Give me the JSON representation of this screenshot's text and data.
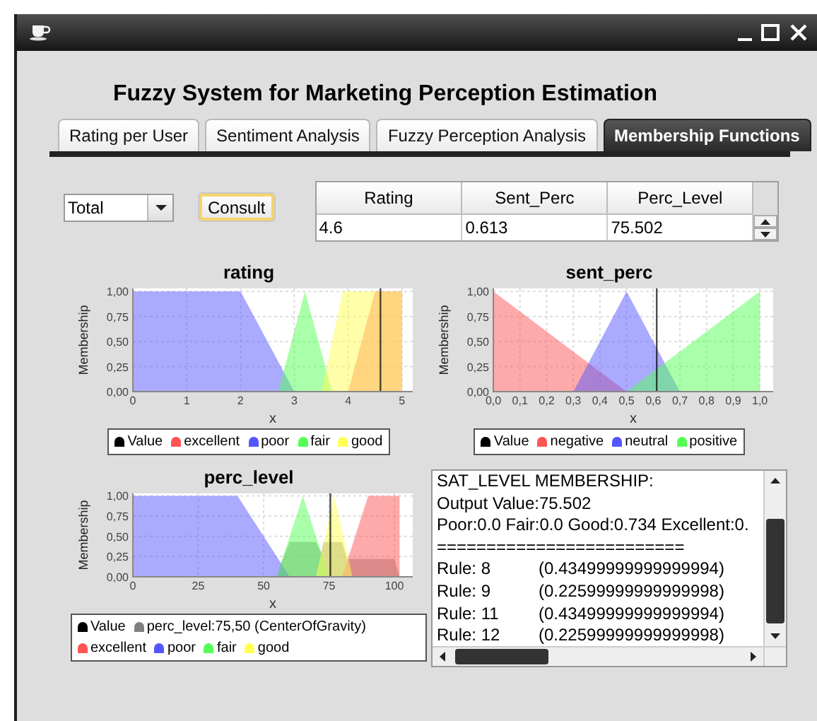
{
  "heading": "Fuzzy System for Marketing Perception Estimation",
  "tabs": [
    {
      "label": "Rating per User",
      "selected": false
    },
    {
      "label": "Sentiment Analysis",
      "selected": false
    },
    {
      "label": "Fuzzy Perception Analysis",
      "selected": false
    },
    {
      "label": "Membership Functions",
      "selected": true
    }
  ],
  "scope_select": {
    "value": "Total"
  },
  "consult_button": {
    "label": "Consult",
    "focused": true
  },
  "results_table": {
    "columns": [
      "Rating",
      "Sent_Perc",
      "Perc_Level"
    ],
    "rows": [
      [
        "4.6",
        "0.613",
        "75.502"
      ]
    ]
  },
  "charts": [
    {
      "chart_data": {
        "type": "area",
        "title": "rating",
        "xlabel": "x",
        "ylabel": "Membership",
        "x": [
          0,
          2,
          2.7,
          3,
          3.2,
          3.5,
          3.7,
          3.9,
          4,
          4.5,
          5,
          5
        ],
        "series": [
          {
            "name": "excellent",
            "color": "#ff5555",
            "values": [
              null,
              null,
              null,
              null,
              null,
              null,
              null,
              null,
              0,
              1,
              1,
              0
            ]
          },
          {
            "name": "poor",
            "color": "#5555ff",
            "values": [
              1,
              1,
              0.3,
              0,
              null,
              null,
              null,
              null,
              null,
              null,
              null,
              null
            ]
          },
          {
            "name": "fair",
            "color": "#55ff55",
            "values": [
              null,
              null,
              0,
              0.6,
              1,
              0.4,
              0,
              null,
              null,
              null,
              null,
              null
            ]
          },
          {
            "name": "good",
            "color": "#ffff55",
            "values": [
              null,
              null,
              null,
              null,
              null,
              0,
              0.5,
              1,
              1,
              1,
              1,
              0
            ]
          }
        ],
        "xlim": [
          0,
          5.2
        ],
        "ylim": [
          0,
          1.03
        ],
        "xticks": [
          0,
          1,
          2,
          3,
          4,
          5
        ],
        "yticks": [
          {
            "value": 0,
            "label": "0,00"
          },
          {
            "value": 0.25,
            "label": "0,25"
          },
          {
            "value": 0.5,
            "label": "0,50"
          },
          {
            "value": 0.75,
            "label": "0,75"
          },
          {
            "value": 1,
            "label": "1,00"
          }
        ],
        "grid": true,
        "ref_lines": [
          {
            "axis": "x",
            "value": 4.6,
            "label": "Value",
            "color": "#000000"
          }
        ]
      }
    },
    {
      "chart_data": {
        "type": "area",
        "title": "sent_perc",
        "xlabel": "x",
        "ylabel": "Membership",
        "x": [
          0,
          0.3,
          0.5,
          0.7,
          1
        ],
        "series": [
          {
            "name": "negative",
            "color": "#ff5555",
            "values": [
              1,
              0.4,
              0,
              null,
              null
            ]
          },
          {
            "name": "neutral",
            "color": "#5555ff",
            "values": [
              null,
              0,
              1,
              0,
              null
            ]
          },
          {
            "name": "positive",
            "color": "#55ff55",
            "values": [
              null,
              null,
              0,
              0.4,
              1
            ]
          }
        ],
        "xlim": [
          0,
          1.05
        ],
        "ylim": [
          0,
          1.03
        ],
        "xticks": [
          {
            "value": 0,
            "label": "0,0"
          },
          {
            "value": 0.1,
            "label": "0,1"
          },
          {
            "value": 0.2,
            "label": "0,2"
          },
          {
            "value": 0.3,
            "label": "0,3"
          },
          {
            "value": 0.4,
            "label": "0,4"
          },
          {
            "value": 0.5,
            "label": "0,5"
          },
          {
            "value": 0.6,
            "label": "0,6"
          },
          {
            "value": 0.7,
            "label": "0,7"
          },
          {
            "value": 0.8,
            "label": "0,8"
          },
          {
            "value": 0.9,
            "label": "0,9"
          },
          {
            "value": 1,
            "label": "1,0"
          }
        ],
        "yticks": [
          {
            "value": 0,
            "label": "0,00"
          },
          {
            "value": 0.25,
            "label": "0,25"
          },
          {
            "value": 0.5,
            "label": "0,50"
          },
          {
            "value": 0.75,
            "label": "0,75"
          },
          {
            "value": 1,
            "label": "1,00"
          }
        ],
        "grid": true,
        "ref_lines": [
          {
            "axis": "x",
            "value": 0.613,
            "label": "Value",
            "color": "#000000"
          }
        ]
      }
    },
    {
      "chart_data": {
        "type": "area",
        "title": "perc_level",
        "xlabel": "x",
        "ylabel": "Membership",
        "x": [
          0,
          40,
          55,
          57,
          60,
          65,
          70,
          72,
          73,
          75,
          77,
          80,
          82,
          84,
          90,
          100,
          102,
          102
        ],
        "series": [
          {
            "name": "perc_level:75,50 (CenterOfGravity)",
            "color": "#808080",
            "values": [
              null,
              null,
              0,
              0.2,
              0.43,
              0.43,
              0.43,
              0.3,
              0.43,
              0.43,
              0.43,
              0.43,
              0.22,
              0.22,
              0.22,
              0.22,
              0,
              null
            ]
          },
          {
            "name": "excellent",
            "color": "#ff5555",
            "values": [
              null,
              null,
              null,
              null,
              null,
              null,
              null,
              null,
              null,
              null,
              null,
              0,
              0.2,
              0.4,
              1,
              1,
              1,
              0
            ]
          },
          {
            "name": "poor",
            "color": "#5555ff",
            "values": [
              1,
              1,
              0.25,
              0.15,
              0,
              null,
              null,
              null,
              null,
              null,
              null,
              null,
              null,
              null,
              null,
              null,
              null,
              null
            ]
          },
          {
            "name": "fair",
            "color": "#55ff55",
            "values": [
              null,
              null,
              0,
              0.2,
              0.5,
              1,
              0.5,
              0.3,
              0.2,
              0,
              null,
              null,
              null,
              null,
              null,
              null,
              null,
              null
            ]
          },
          {
            "name": "good",
            "color": "#ffff55",
            "values": [
              null,
              null,
              null,
              null,
              null,
              null,
              0,
              0.29,
              0.43,
              0.71,
              1,
              0.57,
              0.29,
              0,
              null,
              null,
              null,
              null
            ]
          }
        ],
        "xlim": [
          0,
          107
        ],
        "ylim": [
          0,
          1.03
        ],
        "xticks": [
          0,
          25,
          50,
          75,
          100
        ],
        "yticks": [
          {
            "value": 0,
            "label": "0,00"
          },
          {
            "value": 0.25,
            "label": "0,25"
          },
          {
            "value": 0.5,
            "label": "0,50"
          },
          {
            "value": 0.75,
            "label": "0,75"
          },
          {
            "value": 1,
            "label": "1,00"
          }
        ],
        "grid": true,
        "ref_lines": [
          {
            "axis": "x",
            "value": 75.5,
            "label": "Value",
            "color": "#000000"
          }
        ]
      }
    }
  ],
  "output_log": {
    "lines": [
      {
        "kind": "text",
        "text": "SAT_LEVEL MEMBERSHIP:"
      },
      {
        "kind": "text",
        "text": "Output Value:75.502"
      },
      {
        "kind": "text",
        "text": "Poor:0.0  Fair:0.0  Good:0.734  Excellent:0."
      },
      {
        "kind": "text",
        "text": "========================="
      },
      {
        "kind": "rule",
        "rule": "Rule: 8",
        "weight": "(0.43499999999999994)"
      },
      {
        "kind": "rule",
        "rule": "Rule: 9",
        "weight": "(0.22599999999999998)"
      },
      {
        "kind": "rule",
        "rule": "Rule: 11",
        "weight": "(0.43499999999999994)"
      },
      {
        "kind": "rule",
        "rule": "Rule: 12",
        "weight": "(0.22599999999999998)"
      }
    ]
  }
}
